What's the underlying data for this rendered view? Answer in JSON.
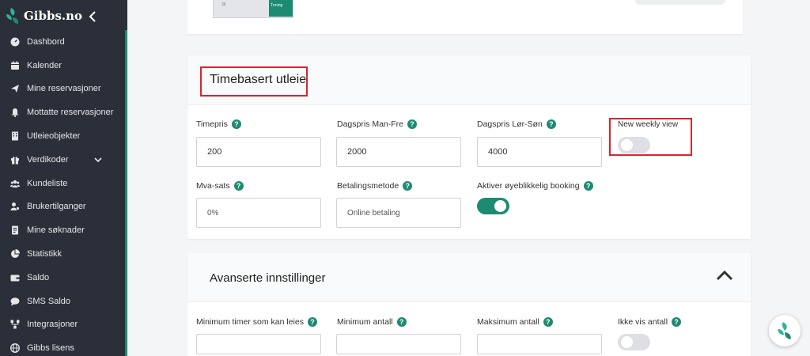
{
  "brand": {
    "name": "Gibbs.no",
    "accent_color": "#1c8b72",
    "sidebar_bg": "#2b2f3a"
  },
  "sidebar": {
    "items": [
      {
        "label": "Dashbord",
        "icon": "dashboard-gauge-icon"
      },
      {
        "label": "Kalender",
        "icon": "calendar-icon"
      },
      {
        "label": "Mine reservasjoner",
        "icon": "paper-plane-icon"
      },
      {
        "label": "Mottatte reservasjoner",
        "icon": "bell-icon"
      },
      {
        "label": "Utleieobjekter",
        "icon": "building-icon"
      },
      {
        "label": "Verdikoder",
        "icon": "gift-icon",
        "has_dropdown": true
      },
      {
        "label": "Kundeliste",
        "icon": "users-icon"
      },
      {
        "label": "Brukertilganger",
        "icon": "user-cog-icon"
      },
      {
        "label": "Mine søknader",
        "icon": "document-icon"
      },
      {
        "label": "Statistikk",
        "icon": "pie-chart-icon"
      },
      {
        "label": "Saldo",
        "icon": "wallet-icon"
      },
      {
        "label": "SMS Saldo",
        "icon": "chat-bubble-icon"
      },
      {
        "label": "Integrasjoner",
        "icon": "network-icon"
      },
      {
        "label": "Gibbs lisens",
        "icon": "globe-icon"
      }
    ]
  },
  "top_card": {
    "thumb_left": "36",
    "thumb_right": "Tnning"
  },
  "hourly": {
    "title": "Timebasert utleie",
    "fields": {
      "hourly_price": {
        "label": "Timepris",
        "value": "200"
      },
      "day_weekday": {
        "label": "Dagspris Man-Fre",
        "value": "2000"
      },
      "day_weekend": {
        "label": "Dagspris Lør-Søn",
        "value": "4000"
      },
      "weekly_view": {
        "label": "New weekly view",
        "on": false
      },
      "vat": {
        "label": "Mva-sats",
        "placeholder": "0%"
      },
      "payment": {
        "label": "Betalingsmetode",
        "placeholder": "Online betaling"
      },
      "instant": {
        "label": "Aktiver øyeblikkelig booking",
        "on": true
      }
    }
  },
  "advanced": {
    "title": "Avanserte innstillinger",
    "fields": {
      "min_hours": {
        "label": "Minimum timer som kan leies"
      },
      "min_qty": {
        "label": "Minimum antall"
      },
      "max_qty": {
        "label": "Maksimum antall"
      },
      "hide_qty": {
        "label": "Ikke vis antall",
        "on": false
      }
    }
  },
  "help_glyph": "?",
  "highlight_color": "#d9262c"
}
